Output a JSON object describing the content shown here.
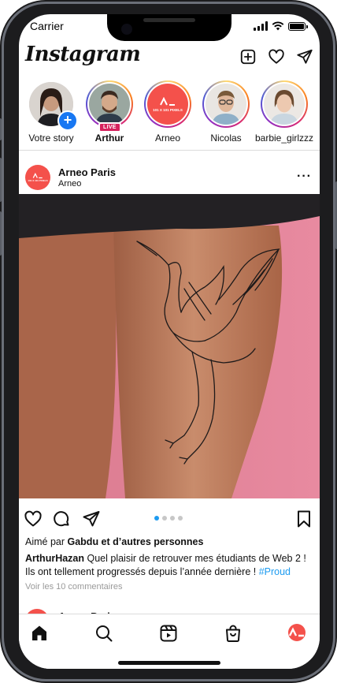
{
  "status_bar": {
    "carrier": "Carrier"
  },
  "header": {
    "logo": "Instagram",
    "icons": [
      "new-post-icon",
      "heart-icon",
      "direct-message-icon"
    ]
  },
  "stories": [
    {
      "label": "Votre story",
      "bold": false,
      "badge": "add",
      "ring": "none"
    },
    {
      "label": "Arthur",
      "bold": true,
      "badge": "LIVE",
      "ring": "gradient"
    },
    {
      "label": "Arneo",
      "bold": false,
      "badge": "",
      "ring": "gradient",
      "avatar_text": "101 X 101 PIXELS"
    },
    {
      "label": "Nicolas",
      "bold": false,
      "badge": "",
      "ring": "gradient"
    },
    {
      "label": "barbie_girlzzz",
      "bold": false,
      "badge": "",
      "ring": "gradient"
    }
  ],
  "post": {
    "username": "Arneo Paris",
    "location": "Arneo",
    "avatar_text": "101 X 101 PIXELS",
    "carousel": {
      "count": 4,
      "active": 1
    },
    "liked_by_prefix": "Aimé par ",
    "liked_by_bold": "Gabdu et d’autres personnes",
    "caption_handle": "ArthurHazan",
    "caption_text": " Quel plaisir de retrouver mes étudiants de Web 2 ! Ils ont tellement progressés depuis l’année dernière ! ",
    "caption_hashtag": "#Proud",
    "comments_link": "Voir les 10 commentaires"
  },
  "next_post": {
    "username": "Arneo Paris"
  },
  "tabbar": {
    "items": [
      "home-icon",
      "search-icon",
      "reels-icon",
      "shop-icon",
      "profile-avatar"
    ]
  },
  "colors": {
    "accent_blue": "#1d9bf0",
    "brand_red": "#f4514b",
    "live_pink": "#d6225e"
  }
}
